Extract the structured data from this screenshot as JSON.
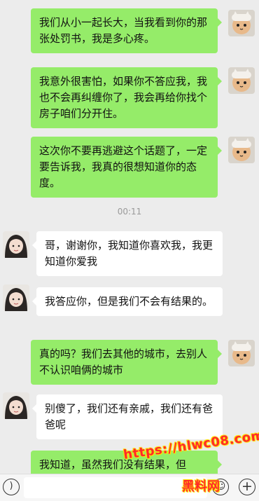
{
  "messages": [
    {
      "side": "me",
      "text": "我们从小一起长大，当我看到你的那张处罚书，我是多心疼。"
    },
    {
      "side": "me",
      "text": "我意外很害怕，如果你不答应我，我也不会再纠缠你了，我会再给你找个房子咱们分开住。"
    },
    {
      "side": "me",
      "text": "这次你不要再逃避这个话题了，一定要告诉我，我真的很想知道你的态度。"
    },
    {
      "side": "other",
      "text": "哥，谢谢你，我知道你喜欢我，我更知道你爱我"
    },
    {
      "side": "other",
      "text": "我答应你，但是我们不会有结果的。"
    },
    {
      "side": "me",
      "text": "真的吗？我们去其他的城市，去别人不认识咱俩的城市"
    },
    {
      "side": "other",
      "text": "别傻了，我们还有亲戚，我们还有爸爸呢"
    },
    {
      "side": "me",
      "text": "我知道，虽然我们没有结果，但"
    }
  ],
  "timestamp": "00:11",
  "watermark": {
    "url": "https://hlwc08.com",
    "name": "黑料网"
  },
  "icons": {
    "voice": "voice-icon",
    "emoji": "emoji-icon",
    "plus": "plus-icon"
  },
  "colors": {
    "me_bubble": "#95ec69",
    "other_bubble": "#ffffff",
    "background": "#ececec"
  }
}
